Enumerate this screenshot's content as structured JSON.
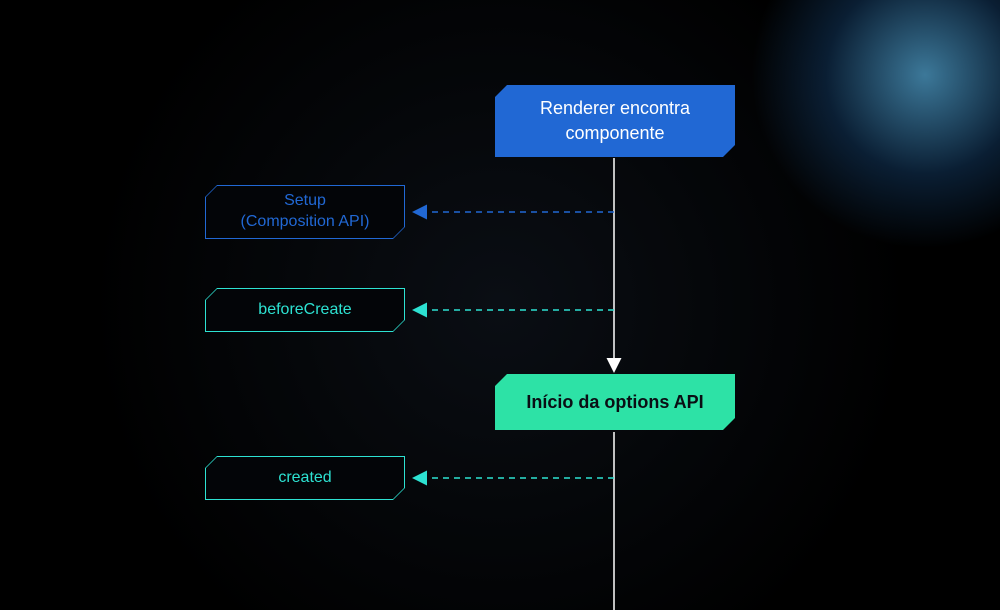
{
  "nodes": {
    "renderer": "Renderer encontra\ncomponente",
    "setup": "Setup\n(Composition API)",
    "beforeCreate": "beforeCreate",
    "optionsApi": "Início da options API",
    "created": "created"
  },
  "colors": {
    "blue": "#2168d4",
    "teal": "#2de2a6",
    "tealLight": "#2de2d2",
    "white": "#ffffff",
    "dark": "#0a0e14"
  }
}
